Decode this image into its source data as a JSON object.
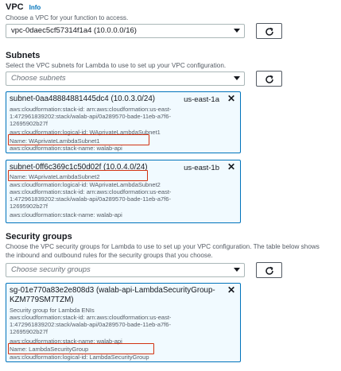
{
  "vpc": {
    "title": "VPC",
    "info": "Info",
    "description": "Choose a VPC for your function to access.",
    "selected": "vpc-0daec5cf57314f1a4 (10.0.0.0/16)"
  },
  "subnets": {
    "title": "Subnets",
    "description": "Select the VPC subnets for Lambda to use to set up your VPC configuration.",
    "placeholder": "Choose subnets",
    "items": [
      {
        "title": "subnet-0aa48884881445dc4 (10.0.3.0/24)",
        "az": "us-east-1a",
        "lines": [
          "aws:cloudformation:stack-id: arn:aws:cloudformation:us-east-",
          "1:472961839202:stack/walab-api/0a289570-bade-11eb-a7f6-",
          "12695902b27f",
          "aws:cloudformation:logical-id: WAprivateLambdaSubnet1",
          "Name: WAprivateLambdaSubnet1",
          "aws:cloudformation:stack-name: walab-api"
        ]
      },
      {
        "title": "subnet-0ff6c369c1c50d02f (10.0.4.0/24)",
        "az": "us-east-1b",
        "lines": [
          "Name: WAprivateLambdaSubnet2",
          "aws:cloudformation:logical-id: WAprivateLambdaSubnet2",
          "aws:cloudformation:stack-id: arn:aws:cloudformation:us-east-",
          "1:472961839202:stack/walab-api/0a289570-bade-11eb-a7f6-",
          "12695902b27f",
          "aws:cloudformation:stack-name: walab-api"
        ]
      }
    ]
  },
  "security_groups": {
    "title": "Security groups",
    "description_line1": "Choose the VPC security groups for Lambda to use to set up your VPC configuration. The table below shows",
    "description_line2": "the inbound and outbound rules for the security groups that you choose.",
    "placeholder": "Choose security groups",
    "item": {
      "title_line1": "sg-01e770a83e2e808d3 (walab-api-LambdaSecurityGroup-",
      "title_line2": "KZM779SM7TZM)",
      "lines": [
        "Security group for Lambda ENIs",
        "aws:cloudformation:stack-id: arn:aws:cloudformation:us-east-",
        "1:472961839202:stack/walab-api/0a289570-bade-11eb-a7f6-",
        "12695902b27f",
        "aws:cloudformation:stack-name: walab-api",
        "Name: LambdaSecurityGroup",
        "aws:cloudformation:logical-id: LambdaSecurityGroup"
      ]
    }
  },
  "colors": {
    "accent": "#0073bb",
    "highlight": "#d13212",
    "card_bg": "#f1faff"
  }
}
